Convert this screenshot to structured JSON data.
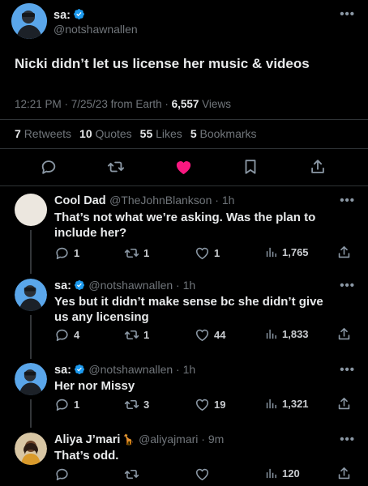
{
  "main_tweet": {
    "name": "sa:",
    "handle": "@notshawnallen",
    "text": "Nicki didn’t let us license her music & videos",
    "time": "12:21 PM · 7/25/23 from Earth ·",
    "views_count": "6,557",
    "views_label": "Views",
    "retweets_count": "7",
    "retweets_label": "Retweets",
    "quotes_count": "10",
    "quotes_label": "Quotes",
    "likes_count": "55",
    "likes_label": "Likes",
    "bookmarks_count": "5",
    "bookmarks_label": "Bookmarks"
  },
  "replies": [
    {
      "name": "Cool Dad",
      "handle": "@TheJohnBlankson · 1h",
      "text": "That’s not what we’re asking. Was the plan to include her?",
      "replies": "1",
      "retweets": "1",
      "likes": "1",
      "views": "1,765"
    },
    {
      "name": "sa:",
      "handle": "@notshawnallen · 1h",
      "text": "Yes but it didn’t make sense bc she didn’t give us any licensing",
      "replies": "4",
      "retweets": "1",
      "likes": "44",
      "views": "1,833"
    },
    {
      "name": "sa:",
      "handle": "@notshawnallen · 1h",
      "text": "Her nor Missy",
      "replies": "1",
      "retweets": "3",
      "likes": "19",
      "views": "1,321"
    },
    {
      "name": "Aliya J’mari",
      "name_emoji": "🦒",
      "handle": "@aliyajmari · 9m",
      "text": "That’s odd.",
      "replies": "",
      "retweets": "",
      "likes": "",
      "views": "120"
    }
  ],
  "more_glyph": "•••",
  "colors": {
    "background": "#000000",
    "verified": "#1d9bf0",
    "like_active": "#f91880",
    "muted": "#71767b"
  },
  "icons": [
    "verified-badge-icon",
    "reply-icon",
    "retweet-icon",
    "heart-icon",
    "bookmark-icon",
    "share-icon",
    "views-icon",
    "more-icon"
  ]
}
